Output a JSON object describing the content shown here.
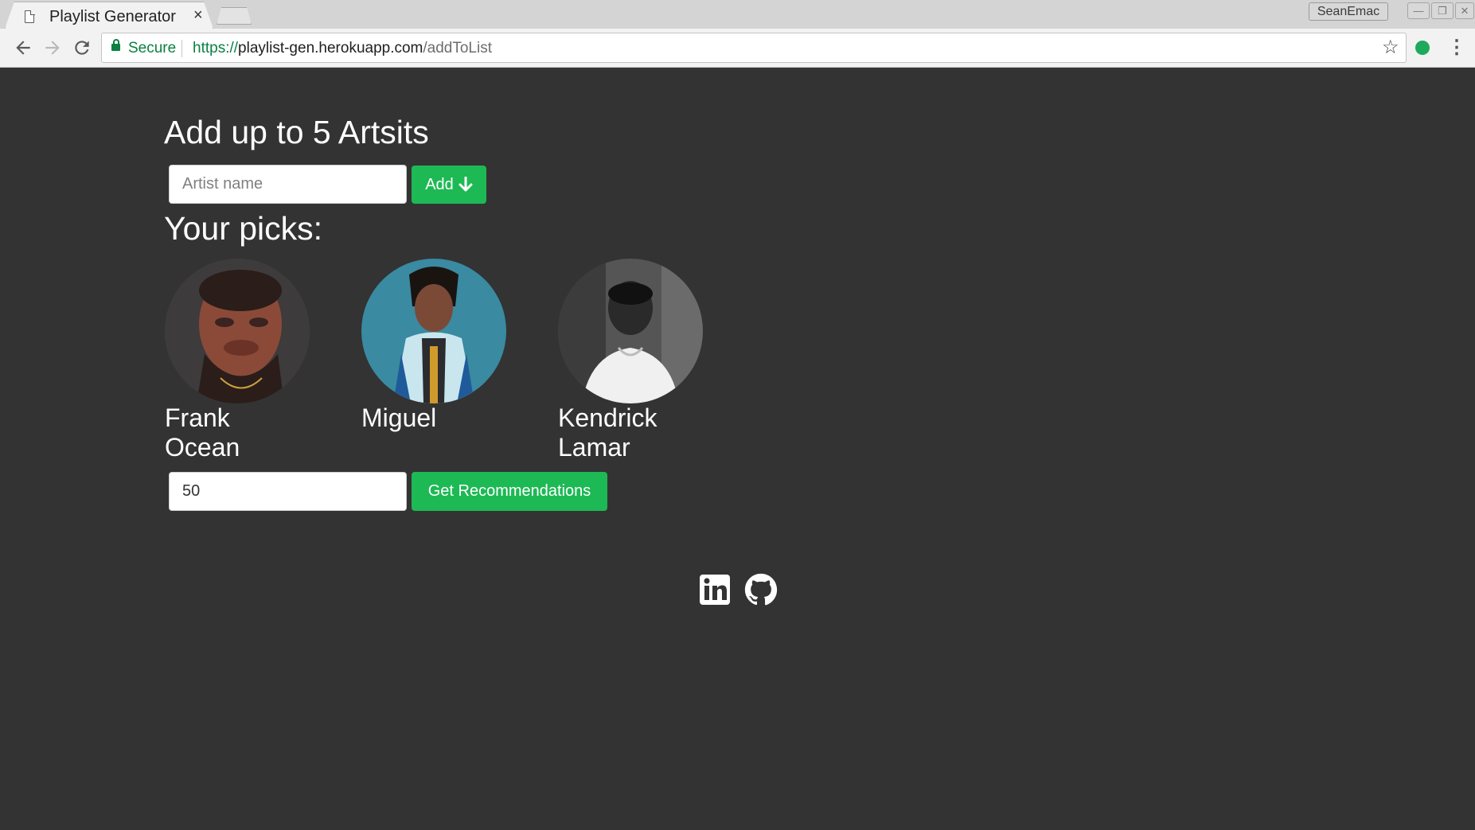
{
  "browser": {
    "tab_title": "Playlist Generator",
    "tab_close": "×",
    "profile_name": "SeanEmac",
    "secure_label": "Secure",
    "url_scheme": "https://",
    "url_host": "playlist-gen.herokuapp.com",
    "url_path": "/addToList"
  },
  "page": {
    "heading": "Add up to 5 Artsits",
    "artist_input": {
      "value": "",
      "placeholder": "Artist name"
    },
    "add_button_label": "Add",
    "picks_heading": "Your picks:",
    "picks": [
      {
        "name": "Frank Ocean"
      },
      {
        "name": "Miguel"
      },
      {
        "name": "Kendrick Lamar"
      }
    ],
    "count_input": {
      "value": "50"
    },
    "recommend_button_label": "Get Recommendations"
  },
  "footer": {
    "icons": [
      "linkedin-icon",
      "github-icon"
    ]
  },
  "colors": {
    "page_background": "#333333",
    "accent": "#1db954",
    "text": "#ffffff"
  }
}
